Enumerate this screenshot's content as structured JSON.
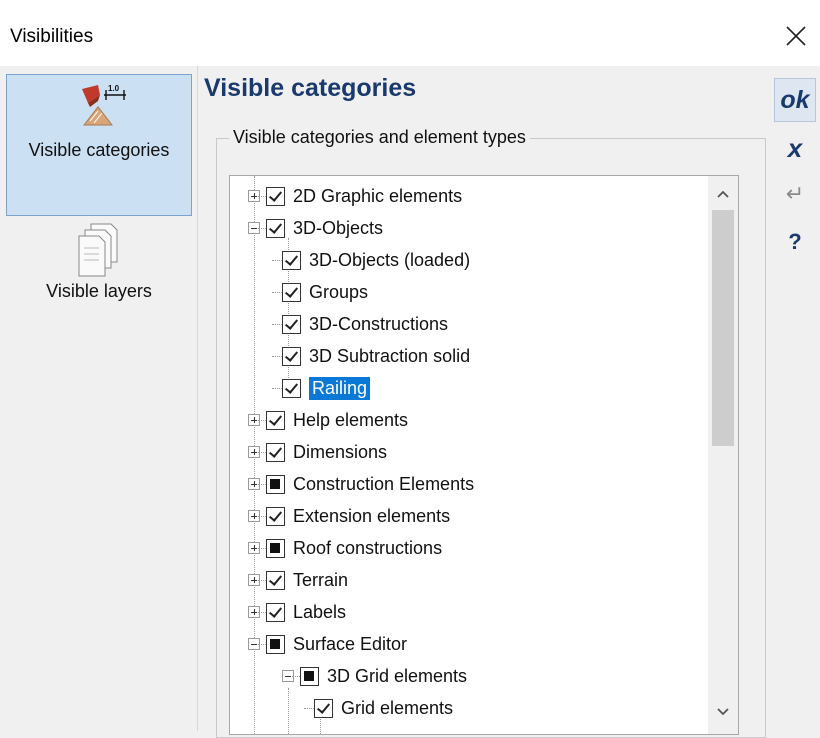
{
  "window": {
    "title": "Visibilities",
    "close_icon": "close-icon"
  },
  "sidebar": {
    "items": [
      {
        "label": "Visible categories",
        "icon": "visible-categories-icon",
        "active": true
      },
      {
        "label": "Visible layers",
        "icon": "layers-icon",
        "active": false
      }
    ],
    "icon_badge": "1.0"
  },
  "main": {
    "heading": "Visible categories",
    "group_label": "Visible categories and element types",
    "tree": [
      {
        "label": "2D Graphic elements",
        "state": "checked",
        "expander": "plus",
        "level": 0
      },
      {
        "label": "3D-Objects",
        "state": "checked",
        "expander": "minus",
        "level": 0
      },
      {
        "label": "3D-Objects (loaded)",
        "state": "checked",
        "expander": "none",
        "level": 1
      },
      {
        "label": "Groups",
        "state": "checked",
        "expander": "none",
        "level": 1
      },
      {
        "label": "3D-Constructions",
        "state": "checked",
        "expander": "none",
        "level": 1
      },
      {
        "label": "3D Subtraction solid",
        "state": "checked",
        "expander": "none",
        "level": 1
      },
      {
        "label": "Railing",
        "state": "checked",
        "expander": "none",
        "level": 1,
        "selected": true
      },
      {
        "label": "Help elements",
        "state": "checked",
        "expander": "plus",
        "level": 0
      },
      {
        "label": "Dimensions",
        "state": "checked",
        "expander": "plus",
        "level": 0
      },
      {
        "label": "Construction Elements",
        "state": "partial",
        "expander": "plus",
        "level": 0
      },
      {
        "label": "Extension elements",
        "state": "checked",
        "expander": "plus",
        "level": 0
      },
      {
        "label": "Roof constructions",
        "state": "partial",
        "expander": "plus",
        "level": 0
      },
      {
        "label": "Terrain",
        "state": "checked",
        "expander": "plus",
        "level": 0
      },
      {
        "label": "Labels",
        "state": "checked",
        "expander": "plus",
        "level": 0
      },
      {
        "label": "Surface Editor",
        "state": "partial",
        "expander": "minus",
        "level": 0
      },
      {
        "label": "3D Grid elements",
        "state": "partial",
        "expander": "minus",
        "level": 1
      },
      {
        "label": "Grid elements",
        "state": "checked",
        "expander": "none",
        "level": 2
      }
    ]
  },
  "toolbar": {
    "ok_label": "ok",
    "cancel_label": "x",
    "apply_label": "↵",
    "help_label": "?"
  },
  "colors": {
    "accent": "#1a3a6e",
    "selection": "#0a78d7",
    "active_item_bg": "#cce0f4"
  }
}
